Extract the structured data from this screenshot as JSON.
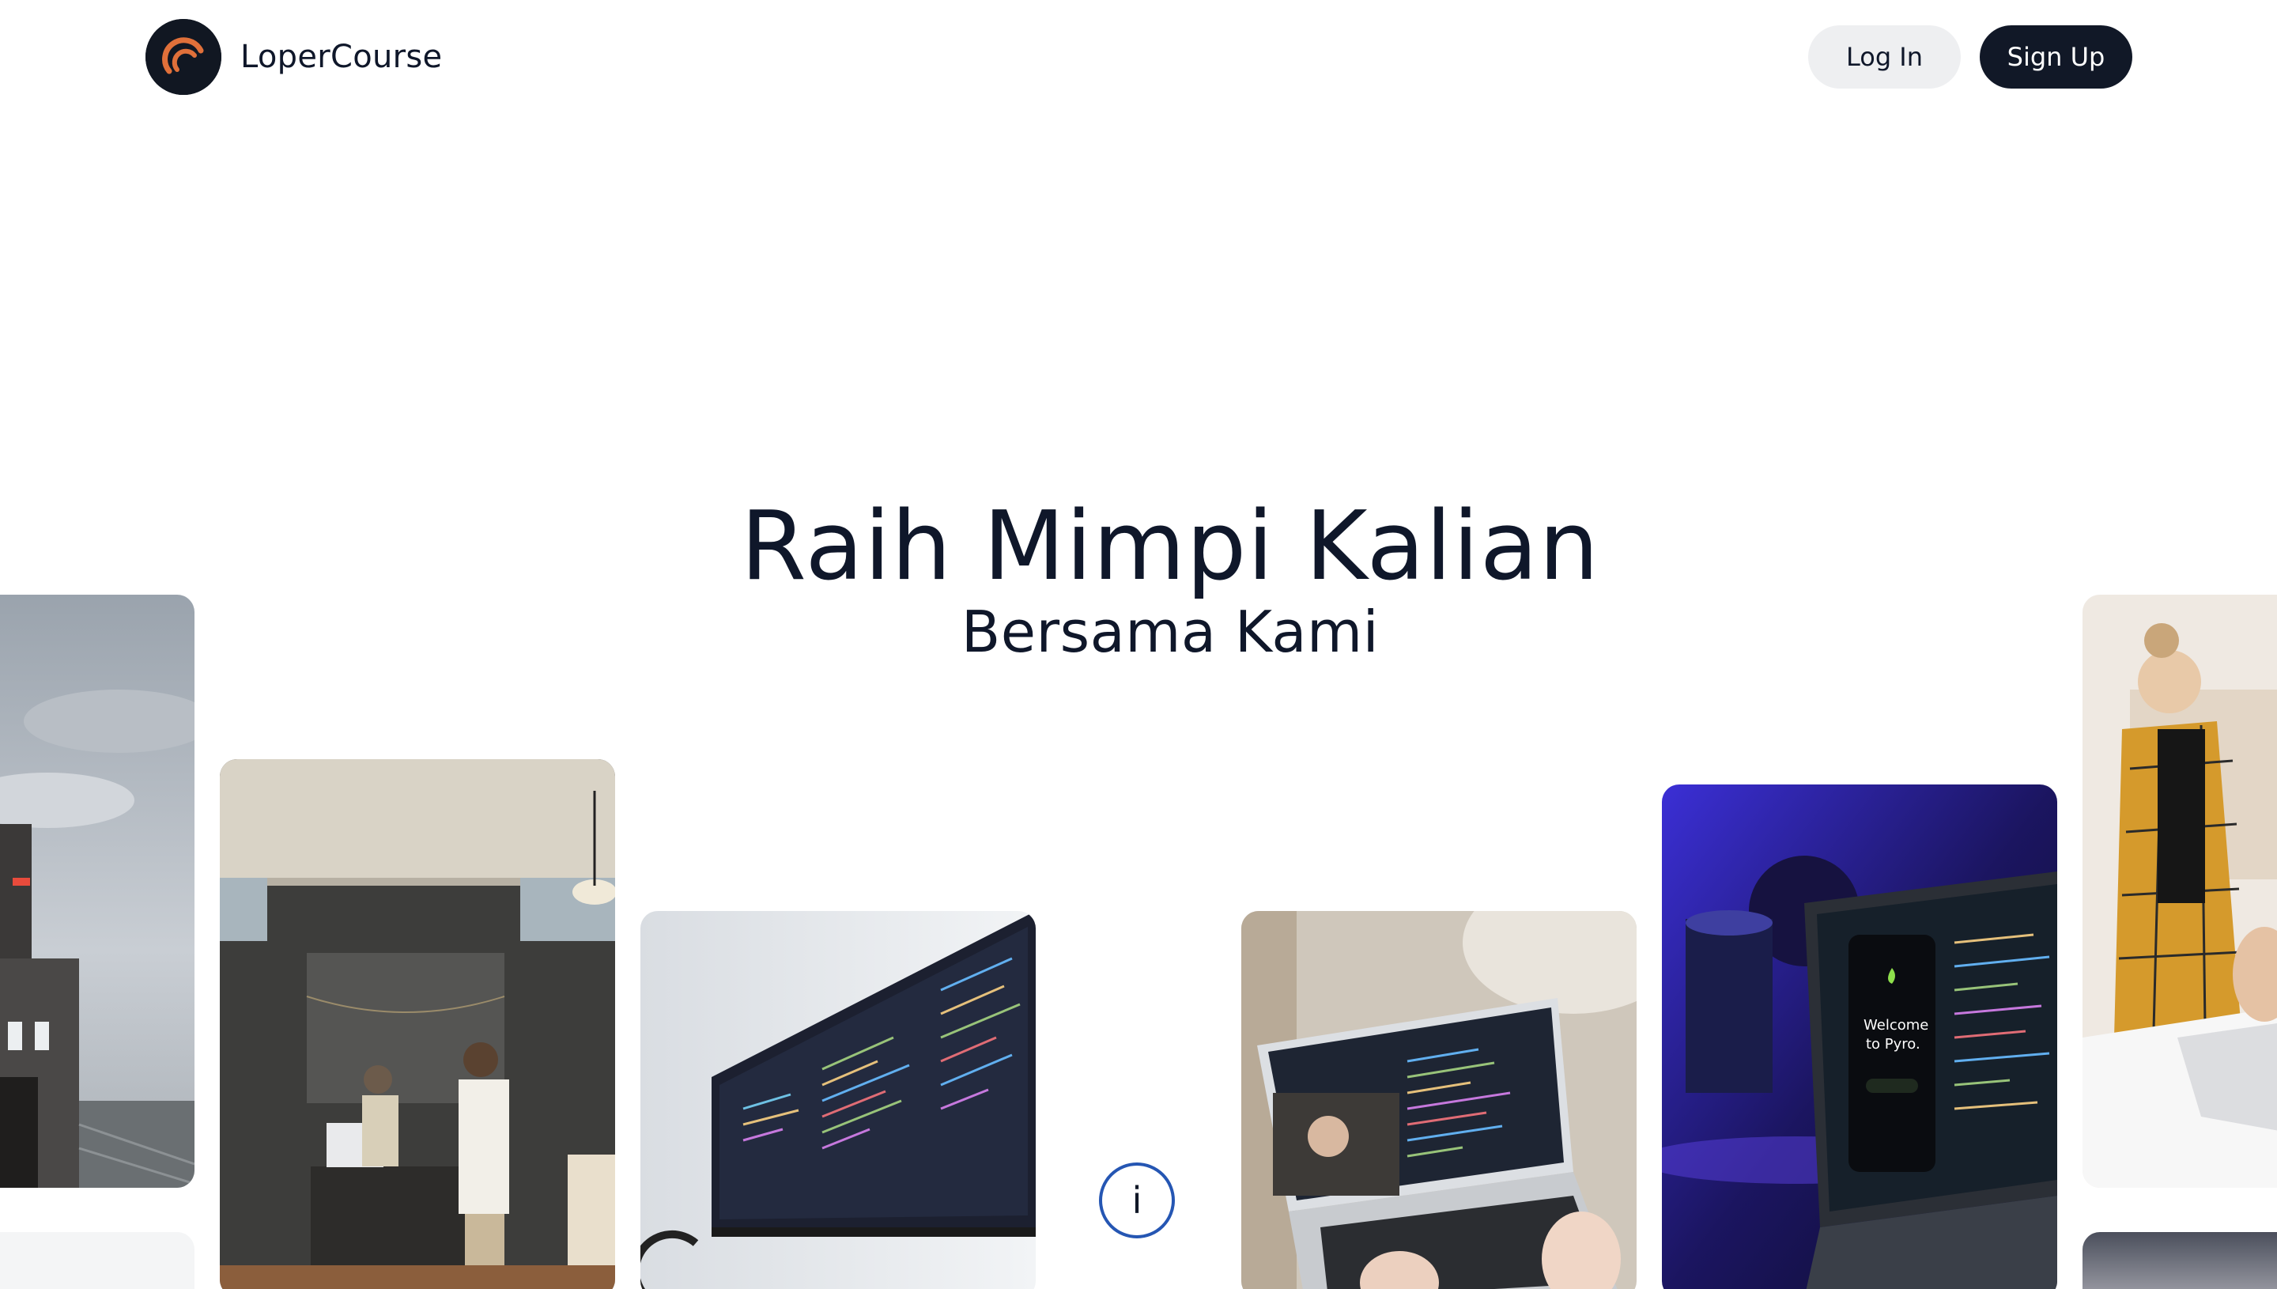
{
  "header": {
    "brand_name": "LoperCourse",
    "login_label": "Log In",
    "signup_label": "Sign Up"
  },
  "hero": {
    "title": "Raih Mimpi Kalian",
    "subtitle": "Bersama Kami"
  },
  "info_button": {
    "label": "i"
  },
  "colors": {
    "primary_dark": "#111827",
    "logo_accent": "#e0703a",
    "info_ring": "#2556b3",
    "login_bg": "#eeeff1"
  },
  "gallery": {
    "images": [
      "building-photo",
      "office-team-photo",
      "code-monitor-photo",
      "laptop-video-call-photo",
      "purple-laptop-photo",
      "woman-laptop-photo"
    ],
    "purple_laptop_text": [
      "Welcome",
      "to Pyro."
    ]
  }
}
